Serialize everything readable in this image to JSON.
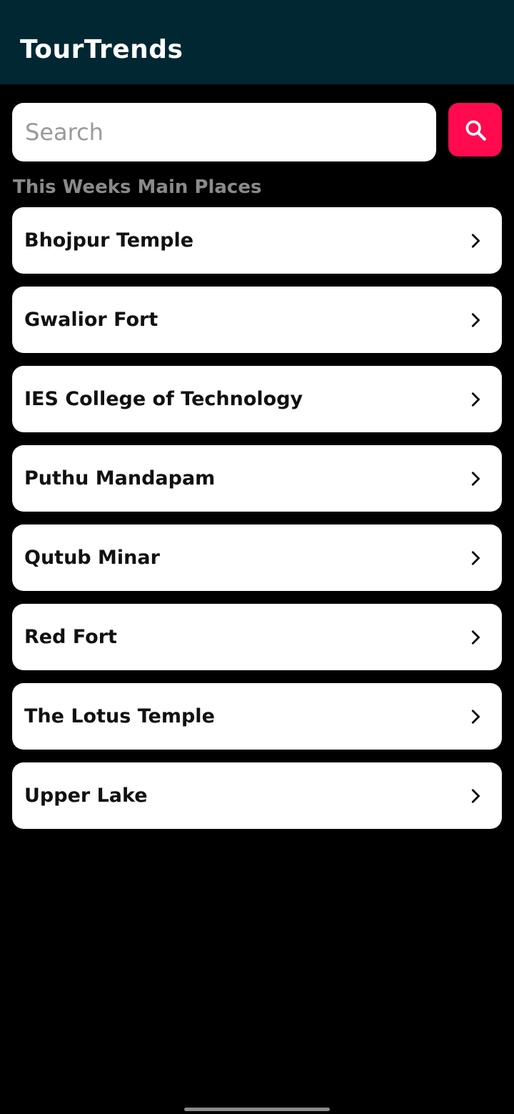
{
  "app_bar": {
    "title": "TourTrends",
    "background": "#012733"
  },
  "search": {
    "placeholder": "Search",
    "value": "",
    "button_icon": "search-icon",
    "button_color": "#ff0a4f"
  },
  "section": {
    "title": "This Weeks Main Places"
  },
  "places": [
    {
      "name": "Bhojpur Temple",
      "icon": "chevron-right-icon"
    },
    {
      "name": "Gwalior Fort",
      "icon": "chevron-right-icon"
    },
    {
      "name": "IES College of Technology",
      "icon": "chevron-right-icon"
    },
    {
      "name": "Puthu Mandapam",
      "icon": "chevron-right-icon"
    },
    {
      "name": "Qutub Minar",
      "icon": "chevron-right-icon"
    },
    {
      "name": "Red Fort",
      "icon": "chevron-right-icon"
    },
    {
      "name": "The Lotus Temple",
      "icon": "chevron-right-icon"
    },
    {
      "name": "Upper Lake",
      "icon": "chevron-right-icon"
    }
  ]
}
